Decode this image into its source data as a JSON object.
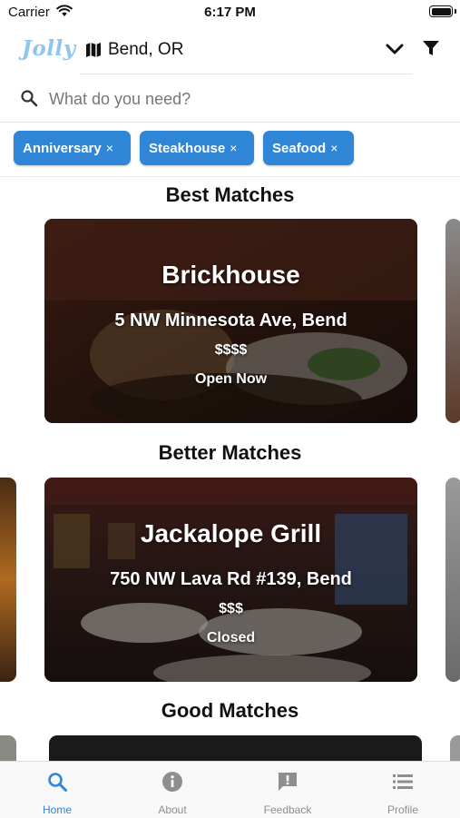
{
  "status_bar": {
    "carrier": "Carrier",
    "time": "6:17 PM"
  },
  "header": {
    "logo": "Jolly",
    "location": "Bend, OR",
    "search_placeholder": "What do you need?"
  },
  "filters": [
    {
      "label": "Anniversary",
      "remove": "×"
    },
    {
      "label": "Steakhouse",
      "remove": "×"
    },
    {
      "label": "Seafood",
      "remove": "×"
    }
  ],
  "sections": [
    {
      "title": "Best Matches",
      "card": {
        "name": "Brickhouse",
        "address": "5 NW Minnesota Ave, Bend",
        "price": "$$$$",
        "status": "Open Now"
      }
    },
    {
      "title": "Better Matches",
      "card": {
        "name": "Jackalope Grill",
        "address": "750 NW Lava Rd #139, Bend",
        "price": "$$$",
        "status": "Closed"
      }
    },
    {
      "title": "Good Matches"
    }
  ],
  "tabs": [
    {
      "label": "Home",
      "icon": "search-icon"
    },
    {
      "label": "About",
      "icon": "info-icon"
    },
    {
      "label": "Feedback",
      "icon": "feedback-icon"
    },
    {
      "label": "Profile",
      "icon": "list-icon"
    }
  ],
  "colors": {
    "accent": "#2f86d6",
    "logo": "#8ec6ef",
    "inactive_tab": "#8e8e8e"
  }
}
